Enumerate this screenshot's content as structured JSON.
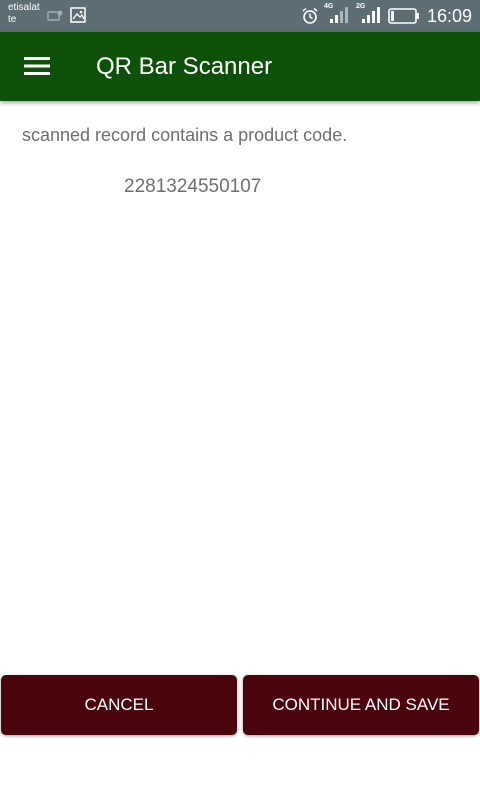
{
  "status_bar": {
    "carrier_line1": "etisalat",
    "carrier_line2": "te",
    "network_1": "4G",
    "network_2": "2G",
    "time": "16:09",
    "icons": [
      "notification-icon",
      "image-icon",
      "alarm-icon",
      "signal-4g-icon",
      "signal-2g-icon",
      "battery-icon"
    ]
  },
  "app_bar": {
    "title": "QR Bar Scanner",
    "menu_icon": "hamburger-menu-icon",
    "background": "#0d5109"
  },
  "content": {
    "message": "scanned record contains a product code.",
    "code": "2281324550107"
  },
  "actions": {
    "cancel_label": "CANCEL",
    "save_label": "CONTINUE AND SAVE",
    "button_color": "#4a040b"
  }
}
